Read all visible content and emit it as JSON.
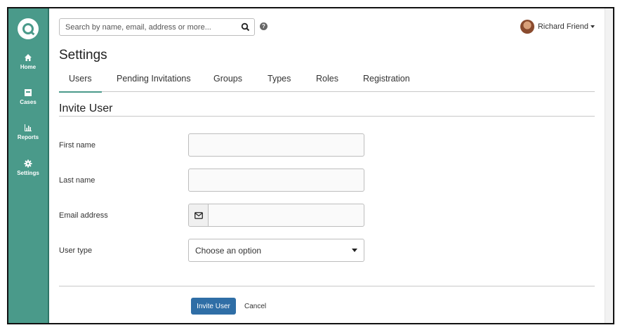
{
  "search": {
    "placeholder": "Search by name, email, address or more..."
  },
  "user": {
    "name": "Richard Friend"
  },
  "sidebar": {
    "items": [
      {
        "label": "Home",
        "icon": "home-icon"
      },
      {
        "label": "Cases",
        "icon": "inbox-icon"
      },
      {
        "label": "Reports",
        "icon": "bar-chart-icon"
      },
      {
        "label": "Settings",
        "icon": "gear-icon"
      }
    ]
  },
  "page": {
    "title": "Settings"
  },
  "tabs": [
    {
      "label": "Users",
      "active": true
    },
    {
      "label": "Pending Invitations"
    },
    {
      "label": "Groups"
    },
    {
      "label": "Types"
    },
    {
      "label": "Roles"
    },
    {
      "label": "Registration"
    }
  ],
  "form": {
    "title": "Invite User",
    "fields": {
      "first_name": {
        "label": "First name",
        "value": ""
      },
      "last_name": {
        "label": "Last name",
        "value": ""
      },
      "email": {
        "label": "Email address",
        "value": ""
      },
      "user_type": {
        "label": "User type",
        "selected": "Choose an option"
      }
    },
    "submit_label": "Invite User",
    "cancel_label": "Cancel"
  },
  "colors": {
    "sidebar": "#4a9a8a",
    "primary_button": "#2f6ea6",
    "tab_active": "#4a9a8a"
  }
}
